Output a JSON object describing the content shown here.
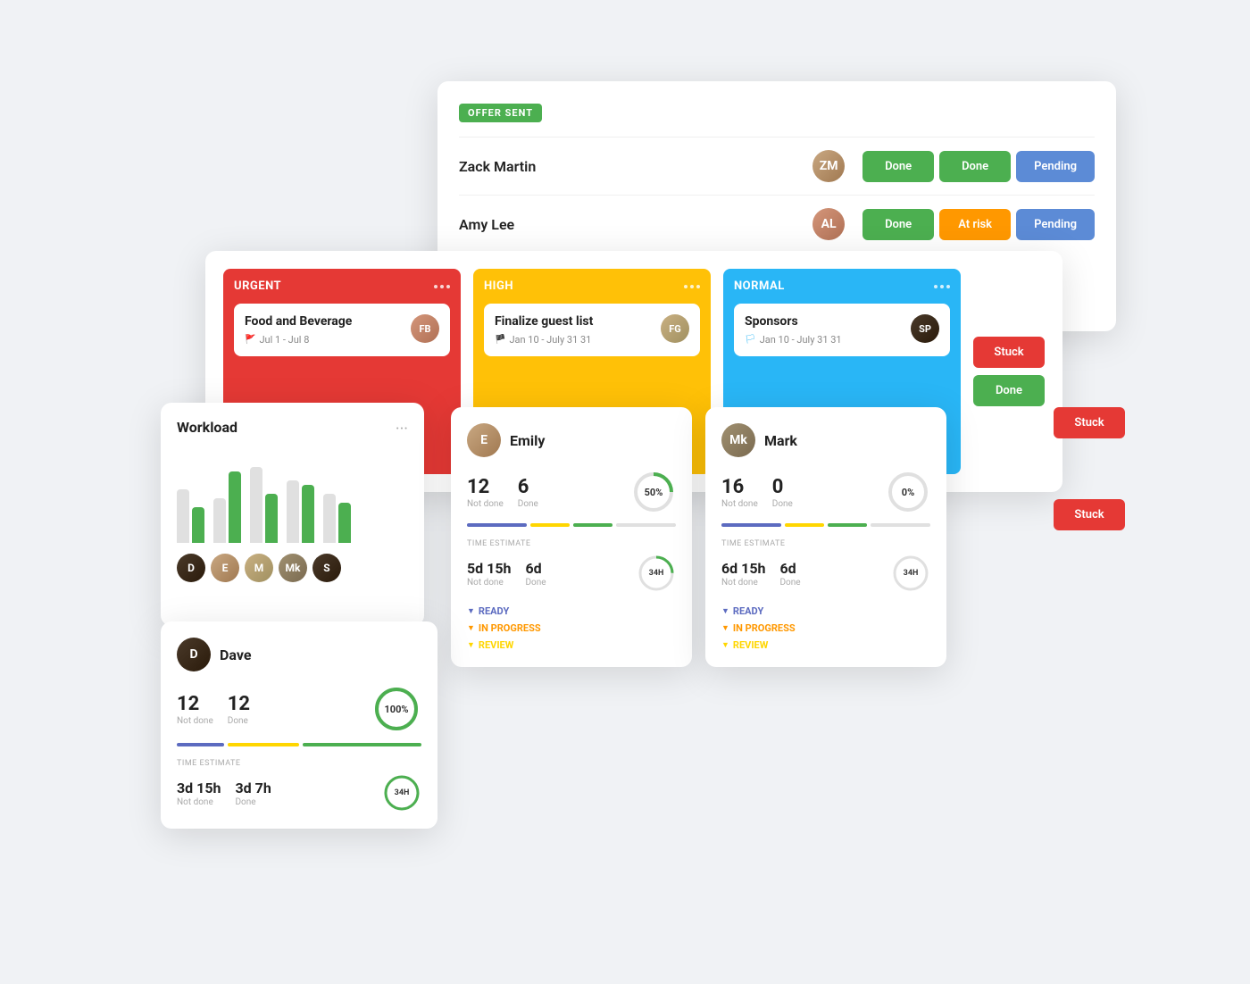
{
  "offer": {
    "badge": "OFFER SENT",
    "people": [
      {
        "name": "Zack Martin",
        "avatar_initials": "ZM",
        "avatar_class": "av-zack",
        "statuses": [
          "Done",
          "Done",
          "Pending"
        ]
      },
      {
        "name": "Amy Lee",
        "avatar_initials": "AL",
        "avatar_class": "av-amy",
        "statuses": [
          "Done",
          "At risk",
          "Pending"
        ]
      }
    ]
  },
  "kanban": {
    "columns": [
      {
        "id": "urgent",
        "title": "URGENT",
        "color_class": "kanban-col-urgent",
        "task": {
          "title": "Food and Beverage",
          "date": "Jul 1 - Jul 8",
          "flag_color": "#e53935",
          "avatar_class": "av-food",
          "avatar_initials": "FB"
        }
      },
      {
        "id": "high",
        "title": "HIGH",
        "color_class": "kanban-col-high",
        "task": {
          "title": "Finalize guest list",
          "date": "Jan 10 - July 31 31",
          "flag_color": "#ffc107",
          "avatar_class": "av-finalize",
          "avatar_initials": "FG"
        }
      },
      {
        "id": "normal",
        "title": "NORMAL",
        "color_class": "kanban-col-normal",
        "task": {
          "title": "Sponsors",
          "date": "Jan 10 - July 31 31",
          "flag_color": "#29b6f6",
          "avatar_class": "av-sponsors",
          "avatar_initials": "SP"
        }
      }
    ],
    "side_statuses": [
      "Stuck",
      "Done"
    ]
  },
  "workload": {
    "title": "Workload",
    "bars": [
      {
        "gray": 60,
        "green": 40
      },
      {
        "gray": 50,
        "green": 80
      },
      {
        "gray": 80,
        "green": 55
      },
      {
        "gray": 70,
        "green": 65
      },
      {
        "gray": 55,
        "green": 45
      }
    ],
    "avatars": [
      {
        "class": "av-dave",
        "initials": "D"
      },
      {
        "class": "av-emily",
        "initials": "E"
      },
      {
        "class": "av-finalize",
        "initials": "M"
      },
      {
        "class": "av-mark",
        "initials": "Mk"
      },
      {
        "class": "av-sponsors",
        "initials": "S"
      }
    ]
  },
  "people": [
    {
      "id": "emily",
      "name": "Emily",
      "avatar_class": "av-emily",
      "avatar_initials": "E",
      "not_done": 12,
      "done": 6,
      "progress_pct": 50,
      "progress_label": "50%",
      "progress_color": "#4caf50",
      "bar_segments": [
        {
          "color": "#5c6bc0",
          "flex": 3
        },
        {
          "color": "#ffd600",
          "flex": 2
        },
        {
          "color": "#4caf50",
          "flex": 2
        },
        {
          "color": "#e0e0e0",
          "flex": 3
        }
      ],
      "time_not_done": "5d 15h",
      "time_done": "6d",
      "time_remaining": "34H",
      "time_remaining_color": "#4caf50",
      "sections": [
        "READY",
        "IN PROGRESS",
        "REVIEW"
      ]
    },
    {
      "id": "mark",
      "name": "Mark",
      "avatar_class": "av-mark",
      "avatar_initials": "Mk",
      "not_done": 16,
      "done": 0,
      "progress_pct": 0,
      "progress_label": "0%",
      "progress_color": "#e0e0e0",
      "bar_segments": [
        {
          "color": "#5c6bc0",
          "flex": 3
        },
        {
          "color": "#ffd600",
          "flex": 2
        },
        {
          "color": "#4caf50",
          "flex": 2
        },
        {
          "color": "#e0e0e0",
          "flex": 3
        }
      ],
      "time_not_done": "6d 15h",
      "time_done": "6d",
      "time_remaining": "34H",
      "time_remaining_color": "#e0e0e0",
      "sections": [
        "READY",
        "IN PROGRESS",
        "REVIEW"
      ]
    }
  ],
  "dave": {
    "name": "Dave",
    "avatar_class": "av-dave",
    "avatar_initials": "D",
    "not_done": 12,
    "done": 12,
    "progress_pct": 100,
    "progress_label": "100%",
    "progress_color": "#4caf50",
    "bar_segments": [
      {
        "color": "#5c6bc0",
        "flex": 2
      },
      {
        "color": "#ffd600",
        "flex": 3
      },
      {
        "color": "#4caf50",
        "flex": 5
      }
    ],
    "time_label": "TIME ESTIMATE",
    "time_not_done": "3d 15h",
    "time_done": "3d 7h",
    "time_remaining": "34H",
    "time_remaining_color": "#4caf50"
  },
  "status_colors": {
    "done": "#4caf50",
    "at_risk": "#ff9800",
    "pending": "#5c8bd6",
    "stuck": "#e53935"
  },
  "labels": {
    "not_done": "Not done",
    "done": "Done",
    "time_estimate": "TIME ESTIMATE",
    "ready": "READY",
    "in_progress": "IN PROGRESS",
    "review": "REVIEW",
    "stuck": "Stuck",
    "workload_dots": "..."
  }
}
